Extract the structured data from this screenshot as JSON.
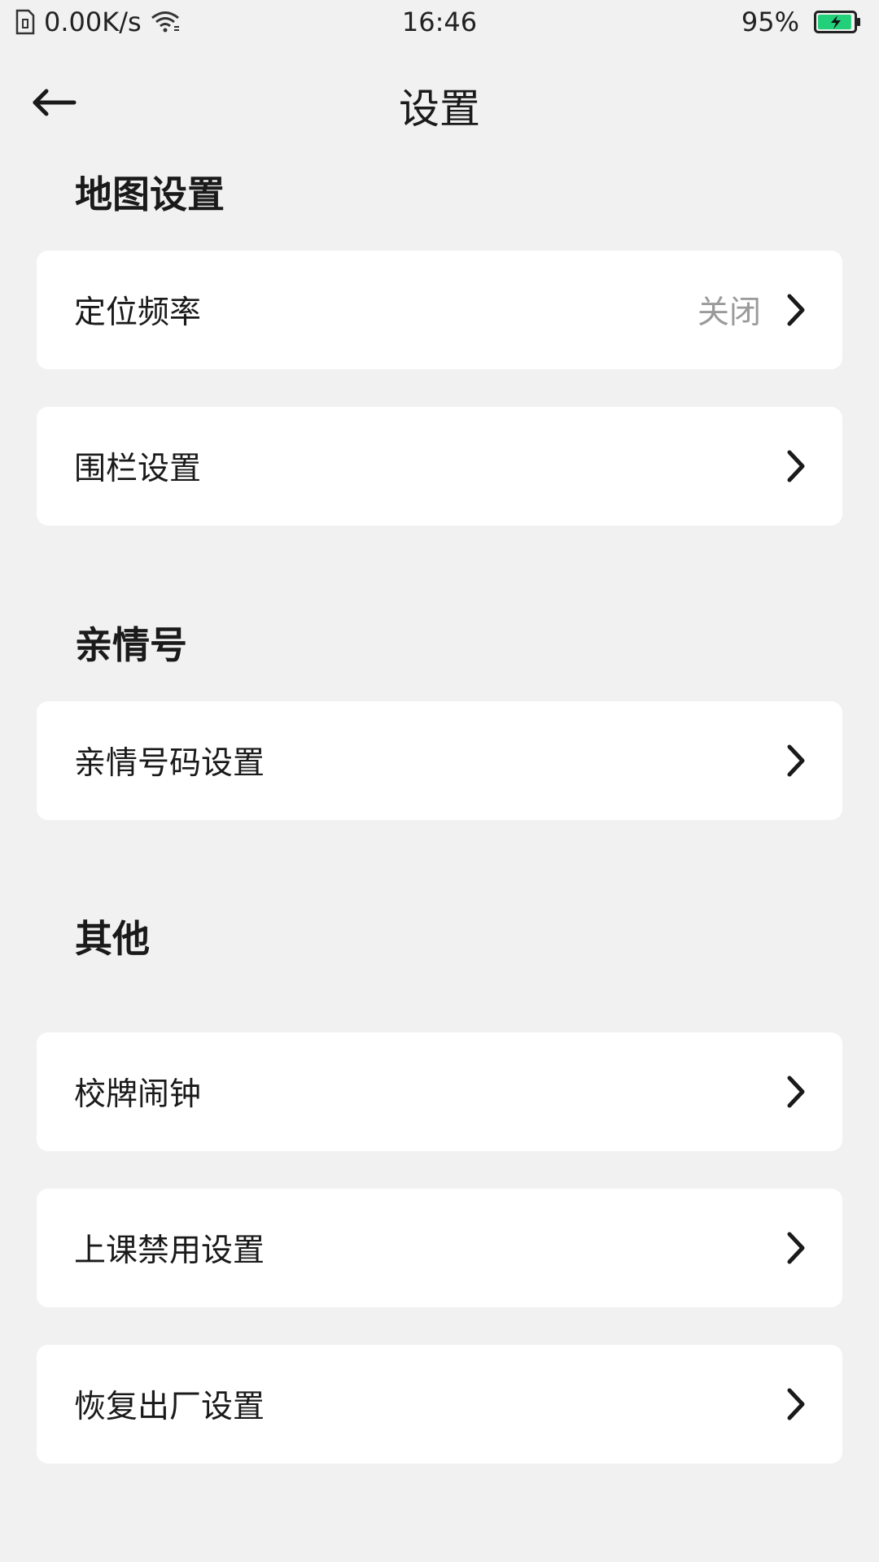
{
  "status_bar": {
    "net_speed": "0.00K/s",
    "time": "16:46",
    "battery_percent": "95%",
    "battery_level": 0.95,
    "battery_color": "#22d07a"
  },
  "header": {
    "back_icon": "arrow-left-icon",
    "title": "设置"
  },
  "sections": [
    {
      "title": "地图设置",
      "items": [
        {
          "label": "定位频率",
          "value": "关闭"
        },
        {
          "label": "围栏设置"
        }
      ]
    },
    {
      "title": "亲情号",
      "items": [
        {
          "label": "亲情号码设置"
        }
      ]
    },
    {
      "title": "其他",
      "items": [
        {
          "label": "校牌闹钟"
        },
        {
          "label": "上课禁用设置"
        },
        {
          "label": "恢复出厂设置"
        }
      ]
    }
  ],
  "colors": {
    "background": "#f1f1f1",
    "card": "#ffffff",
    "secondary_text": "#9a9a9a"
  }
}
